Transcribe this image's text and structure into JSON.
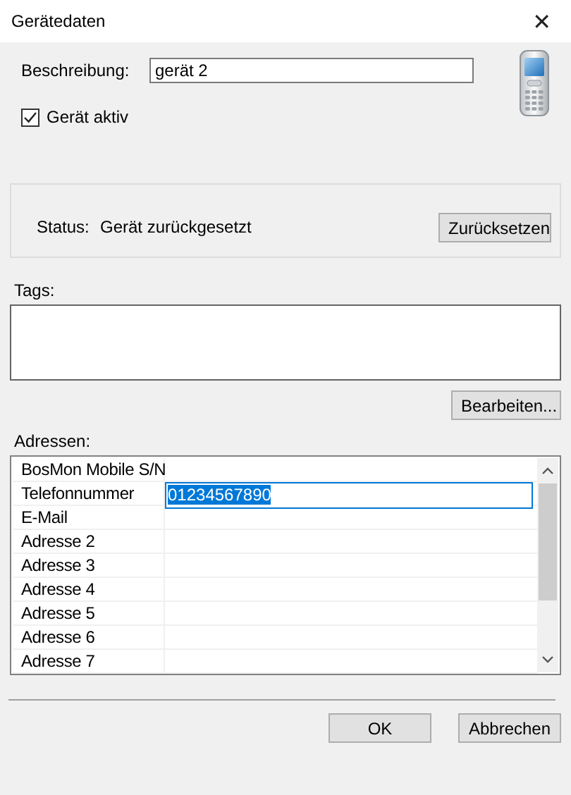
{
  "window": {
    "title": "Gerätedaten",
    "close": "✕"
  },
  "description": {
    "label": "Beschreibung:",
    "value": "gerät 2"
  },
  "active": {
    "label": "Gerät aktiv",
    "checked": true
  },
  "status": {
    "label": "Status:",
    "value": "Gerät zurückgesetzt",
    "button": "Zurücksetzen"
  },
  "tags": {
    "label": "Tags:",
    "button": "Bearbeiten..."
  },
  "addresses": {
    "label": "Adressen:",
    "rows": [
      {
        "name": "BosMon Mobile S/N",
        "editing": false
      },
      {
        "name": "Telefonnummer",
        "value": "01234567890",
        "editing": true
      },
      {
        "name": "E-Mail",
        "editing": false
      },
      {
        "name": "Adresse 2",
        "editing": false
      },
      {
        "name": "Adresse 3",
        "editing": false
      },
      {
        "name": "Adresse 4",
        "editing": false
      },
      {
        "name": "Adresse 5",
        "editing": false
      },
      {
        "name": "Adresse 6",
        "editing": false
      },
      {
        "name": "Adresse 7",
        "editing": false
      }
    ]
  },
  "buttons": [
    "OK",
    "Abbrechen"
  ]
}
